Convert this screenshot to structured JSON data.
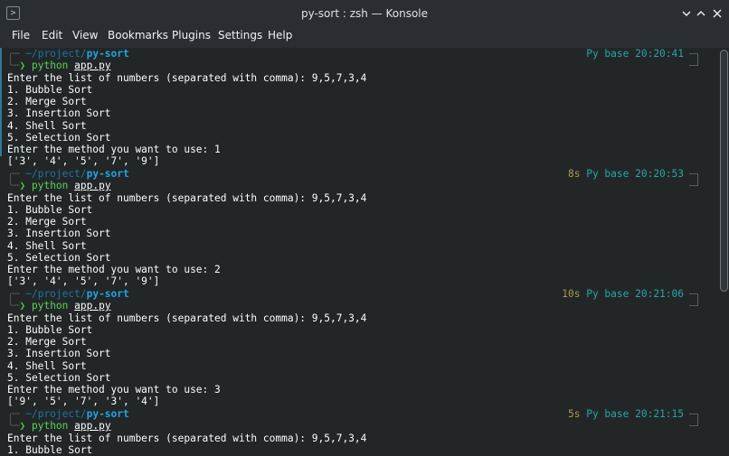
{
  "window": {
    "title": "py-sort : zsh — Konsole",
    "app_icon": ">"
  },
  "menubar": [
    "File",
    "Edit",
    "View",
    "Bookmarks",
    "Plugins",
    "Settings",
    "Help"
  ],
  "prompt": {
    "frame_top": "╭─",
    "frame_bottom": "╰─",
    "path_prefix": "~/project/",
    "path_dir": "py-sort",
    "arrow": "❯",
    "command": "python",
    "argument": "app.py",
    "env_label": "Py base"
  },
  "session": {
    "input_prompt": "Enter the list of numbers (separated with comma): 9,5,7,3,4",
    "menu": [
      "1. Bubble Sort",
      "2. Merge Sort",
      "3. Insertion Sort",
      "4. Shell Sort",
      "5. Selection Sort"
    ],
    "method_prompt": "Enter the method you want to use: "
  },
  "runs": [
    {
      "duration": "",
      "time": "20:20:41",
      "method": "1",
      "result": "['3', '4', '5', '7', '9']"
    },
    {
      "duration": "8s",
      "time": "20:20:53",
      "method": "2",
      "result": "['3', '4', '5', '7', '9']"
    },
    {
      "duration": "10s",
      "time": "20:21:06",
      "method": "3",
      "result": "['9', '5', '7', '3', '4']"
    },
    {
      "duration": "5s",
      "time": "20:21:15",
      "method": "",
      "result": ""
    }
  ],
  "colors": {
    "path": "#1ea5e3",
    "arrow": "#46c146",
    "duration": "#a89a47",
    "pyenv": "#26a6a6"
  }
}
